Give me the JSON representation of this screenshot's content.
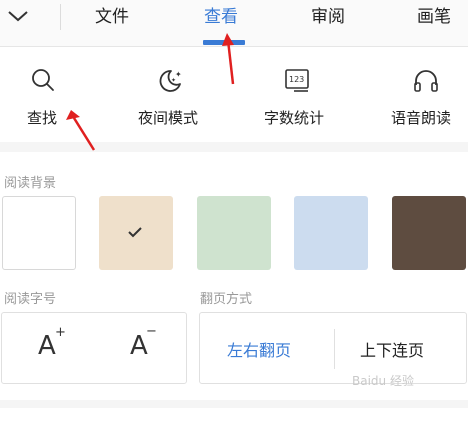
{
  "tabs": [
    {
      "label": "文件",
      "active": false
    },
    {
      "label": "查看",
      "active": true
    },
    {
      "label": "审阅",
      "active": false
    },
    {
      "label": "画笔",
      "active": false
    }
  ],
  "tools": [
    {
      "label": "查找",
      "icon": "search-icon"
    },
    {
      "label": "夜间模式",
      "icon": "night-mode-icon"
    },
    {
      "label": "字数统计",
      "icon": "word-count-icon"
    },
    {
      "label": "语音朗读",
      "icon": "headphones-icon"
    }
  ],
  "word_count_icon_text": "123",
  "reading_background": {
    "title": "阅读背景",
    "swatches": [
      {
        "color": "#ffffff",
        "selected": false
      },
      {
        "color": "#efe0cb",
        "selected": true
      },
      {
        "color": "#cfe3cf",
        "selected": false
      },
      {
        "color": "#ccdcef",
        "selected": false
      },
      {
        "color": "#5e4c40",
        "selected": false
      }
    ]
  },
  "font_size": {
    "title": "阅读字号",
    "increase": "A",
    "decrease": "A",
    "plus": "+",
    "minus": "−"
  },
  "page_mode": {
    "title": "翻页方式",
    "options": [
      "左右翻页",
      "上下连页"
    ],
    "selected": 0
  },
  "colors": {
    "accent": "#3a7bd5",
    "annotation_arrow": "#e02020"
  },
  "watermark": "Baidu 经验"
}
